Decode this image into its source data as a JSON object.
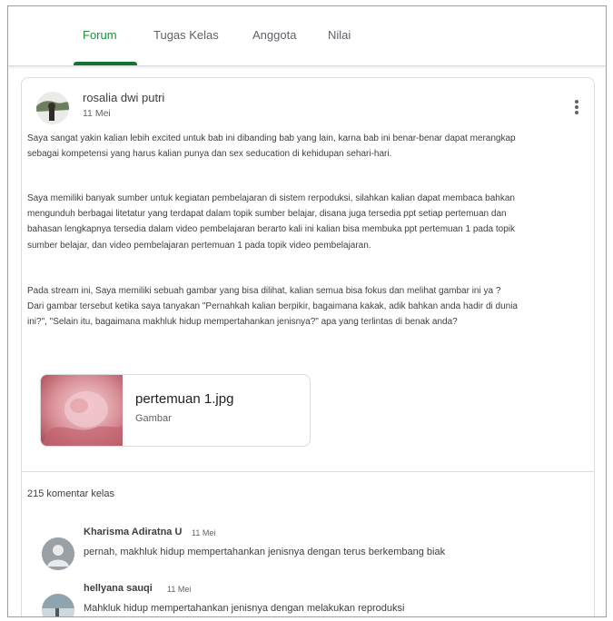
{
  "tabs": [
    {
      "label": "Forum",
      "active": true
    },
    {
      "label": "Tugas Kelas",
      "active": false
    },
    {
      "label": "Anggota",
      "active": false
    },
    {
      "label": "Nilai",
      "active": false
    }
  ],
  "post": {
    "author": "rosalia dwi putri",
    "date": "11 Mei",
    "paragraphs": [
      "Saya sangat yakin kalian lebih excited untuk bab ini dibanding bab yang lain, karna bab ini benar-benar dapat merangkap\nsebagai kompetensi yang harus kalian punya dan sex seducation di kehidupan sehari-hari.",
      "Saya memiliki banyak sumber untuk kegiatan pembelajaran di sistem rerpoduksi, silahkan kalian dapat membaca bahkan\nmengunduh berbagai litetatur yang terdapat dalam topik sumber belajar, disana juga tersedia ppt setiap pertemuan dan\nbahasan lengkapnya tersedia dalam video pembelajaran berarto kali ini kalian bisa membuka ppt pertemuan 1 pada topik\nsumber belajar, dan video pembelajaran pertemuan 1 pada topik video pembelajaran.",
      "Pada stream ini, Saya memiliki sebuah gambar yang bisa dilihat, kalian semua bisa fokus dan melihat gambar ini ya ?\nDari gambar tersebut ketika saya tanyakan \"Pernahkah kalian berpikir, bagaimana kakak, adik bahkan anda hadir di dunia\nini?\", \"Selain itu, bagaimana makhluk hidup mempertahankan jenisnya?\" apa yang terlintas di benak anda?"
    ],
    "attachment": {
      "title": "pertemuan 1.jpg",
      "type": "Gambar"
    }
  },
  "comments_header": "215 komentar kelas",
  "comments": [
    {
      "author": "Kharisma Adiratna U",
      "date": "11 Mei",
      "text": "pernah, makhluk hidup mempertahankan jenisnya dengan terus berkembang biak"
    },
    {
      "author": "hellyana sauqi",
      "date": "11 Mei",
      "text": "Mahkluk hidup mempertahankan jenisnya dengan melakukan reproduksi"
    }
  ],
  "colors": {
    "accent": "#137333",
    "active_tab_text": "#1e8e3e",
    "text": "#3c4043",
    "muted": "#5f6368",
    "border": "#dadce0"
  },
  "icons": {
    "more": "more-vert-icon",
    "avatar": "person-avatar-icon"
  }
}
